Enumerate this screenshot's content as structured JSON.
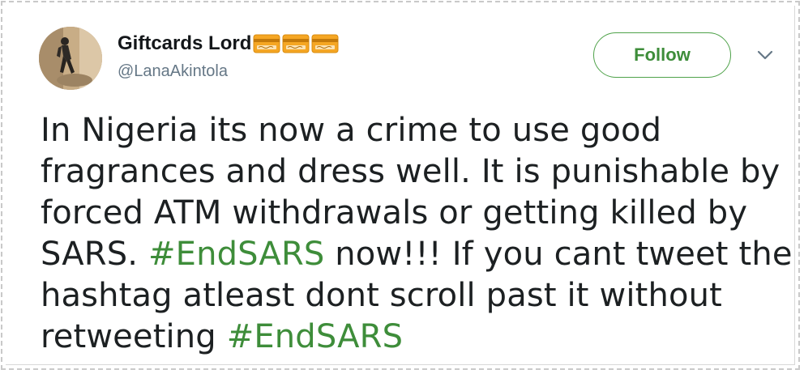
{
  "user": {
    "display_name": "Giftcards Lord",
    "name_emoji": [
      "credit-card-icon",
      "credit-card-icon",
      "credit-card-icon"
    ],
    "handle": "@LanaAkintola",
    "avatar_icon": "profile-photo"
  },
  "actions": {
    "follow_label": "Follow",
    "more_icon": "chevron-down-icon"
  },
  "tweet": {
    "lines": [
      {
        "text": "In Nigeria its now a crime to use good"
      },
      {
        "text": "fragrances and dress well. It is punishable by"
      },
      {
        "text": "forced ATM withdrawals or getting killed by"
      },
      {
        "pre": "SARS. ",
        "hashtag": "#EndSARS",
        "post": " now!!! If you cant tweet the"
      },
      {
        "text": "hashtag atleast dont scroll past it without"
      },
      {
        "pre": "retweeting ",
        "hashtag": "#EndSARS",
        "post": ""
      }
    ]
  },
  "colors": {
    "accent": "#3e8d3a",
    "text": "#1c2022",
    "muted": "#657786",
    "card": "#f5a623"
  }
}
